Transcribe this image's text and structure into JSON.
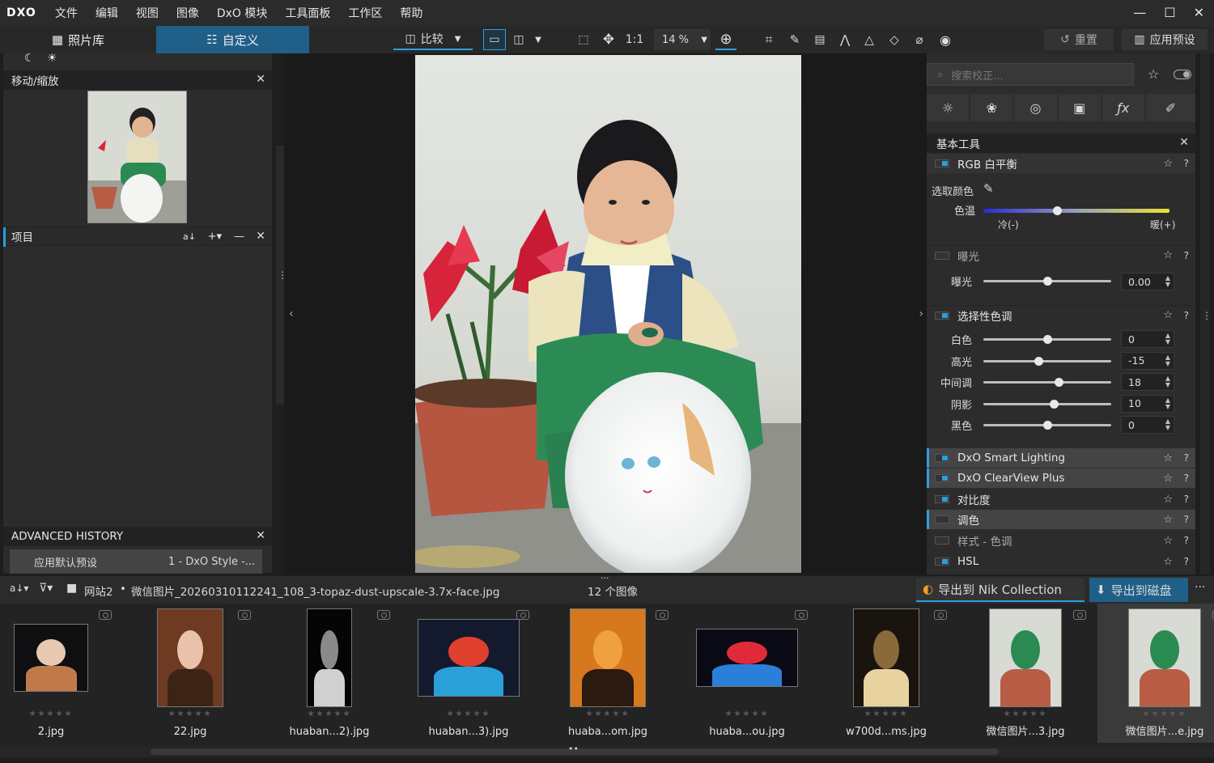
{
  "menu": {
    "logo": "DXO",
    "items": [
      "文件",
      "编辑",
      "视图",
      "图像",
      "DxO 模块",
      "工具面板",
      "工作区",
      "帮助"
    ]
  },
  "tabs": {
    "library": "照片库",
    "customize": "自定义"
  },
  "toolbar": {
    "compare": "比较",
    "ratio": "1:1",
    "zoom": "14 %",
    "reset": "重置",
    "apply_preset": "应用预设"
  },
  "left": {
    "move_zoom": "移动/缩放",
    "projects": "项目",
    "history_title": "ADVANCED HISTORY",
    "history_item_1": "应用默认预设",
    "history_item_2": "1 - DxO Style -..."
  },
  "right": {
    "search_placeholder": "搜索校正...",
    "basic_tools": "基本工具",
    "rgb_wb": "RGB 白平衡",
    "pick_color": "选取颜色",
    "temperature": "色温",
    "cold": "冷(-)",
    "warm": "暖(+)",
    "exposure_section": "曝光",
    "exposure_label": "曝光",
    "exposure_value": "0.00",
    "selective_tone": "选择性色调",
    "tones": [
      {
        "label": "白色",
        "value": "0",
        "level": 0.5
      },
      {
        "label": "高光",
        "value": "-15",
        "level": 0.43
      },
      {
        "label": "中间调",
        "value": "18",
        "level": 0.59
      },
      {
        "label": "阴影",
        "value": "10",
        "level": 0.55
      },
      {
        "label": "黑色",
        "value": "0",
        "level": 0.5
      }
    ],
    "smart_lighting": "DxO Smart Lighting",
    "clearview": "DxO ClearView Plus",
    "contrast": "对比度",
    "toning": "调色",
    "style_toning": "样式 - 色调",
    "hsl": "HSL"
  },
  "filmstrip": {
    "folder": "网站2",
    "filename": "微信图片_20260310112241_108_3-topaz-dust-upscale-3.7x-face.jpg",
    "count": "12 个图像",
    "export_nik": "导出到 Nik Collection",
    "export_disk": "导出到磁盘",
    "thumbs": [
      "2.jpg",
      "22.jpg",
      "huaban...2).jpg",
      "huaban...3).jpg",
      "huaba...om.jpg",
      "huaba...ou.jpg",
      "w700d...ms.jpg",
      "微信图片...3.jpg",
      "微信图片...e.jpg"
    ]
  },
  "colors": {
    "accent": "#1f5f88",
    "check": "#2a9fe0"
  }
}
